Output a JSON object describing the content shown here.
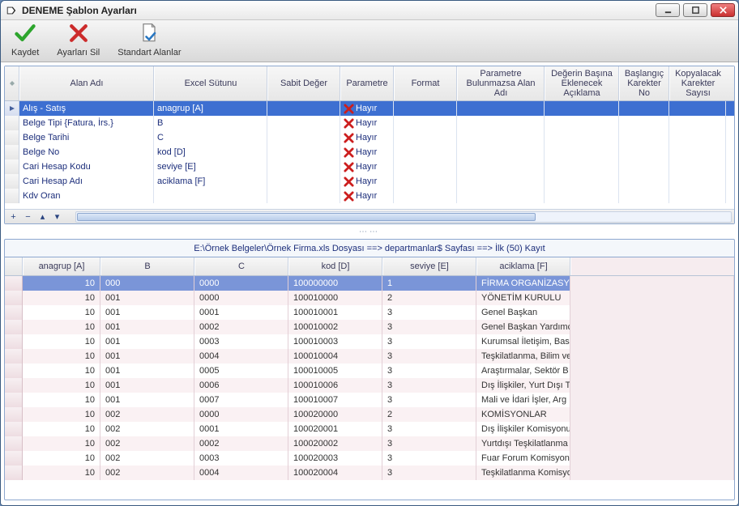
{
  "window": {
    "title": "DENEME Şablon Ayarları"
  },
  "toolbar": {
    "save": "Kaydet",
    "delete": "Ayarları Sil",
    "stdfields": "Standart Alanlar"
  },
  "grid1": {
    "headers": [
      "Alan Adı",
      "Excel Sütunu",
      "Sabit Değer",
      "Parametre",
      "Format",
      "Parametre Bulunmazsa Alan Adı",
      "Değerin Başına Eklenecek Açıklama",
      "Başlangıç Karekter No",
      "Kopyalacak Karekter Sayısı"
    ],
    "rows": [
      {
        "alan": "Alış - Satış",
        "excel": "anagrup [A]",
        "param": "Hayır",
        "selected": true
      },
      {
        "alan": "Belge Tipi {Fatura, İrs.}",
        "excel": "B",
        "param": "Hayır"
      },
      {
        "alan": "Belge Tarihi",
        "excel": "C",
        "param": "Hayır"
      },
      {
        "alan": "Belge No",
        "excel": "kod [D]",
        "param": "Hayır"
      },
      {
        "alan": "Cari Hesap Kodu",
        "excel": "seviye [E]",
        "param": "Hayır"
      },
      {
        "alan": "Cari Hesap Adı",
        "excel": "aciklama [F]",
        "param": "Hayır"
      },
      {
        "alan": "Kdv Oran",
        "excel": "",
        "param": "Hayır"
      }
    ]
  },
  "pathbar": "E:\\Örnek Belgeler\\Örnek Firma.xls Dosyası ==> departmanlar$ Sayfası ==> İlk (50) Kayıt",
  "grid2": {
    "headers": [
      "anagrup [A]",
      "B",
      "C",
      "kod [D]",
      "seviye [E]",
      "aciklama [F]"
    ],
    "rows": [
      {
        "a": "10",
        "b": "000",
        "c": "0000",
        "d": "100000000",
        "e": "1",
        "f": "FİRMA ORGANİZASYO",
        "selected": true
      },
      {
        "a": "10",
        "b": "001",
        "c": "0000",
        "d": "100010000",
        "e": "2",
        "f": "YÖNETİM KURULU"
      },
      {
        "a": "10",
        "b": "001",
        "c": "0001",
        "d": "100010001",
        "e": "3",
        "f": "Genel Başkan"
      },
      {
        "a": "10",
        "b": "001",
        "c": "0002",
        "d": "100010002",
        "e": "3",
        "f": "Genel Başkan Yardımcı"
      },
      {
        "a": "10",
        "b": "001",
        "c": "0003",
        "d": "100010003",
        "e": "3",
        "f": "Kurumsal İletişim,  Bas"
      },
      {
        "a": "10",
        "b": "001",
        "c": "0004",
        "d": "100010004",
        "e": "3",
        "f": "Teşkilatlanma, Bilim ve"
      },
      {
        "a": "10",
        "b": "001",
        "c": "0005",
        "d": "100010005",
        "e": "3",
        "f": "Araştırmalar, Sektör B"
      },
      {
        "a": "10",
        "b": "001",
        "c": "0006",
        "d": "100010006",
        "e": "3",
        "f": "Dış İlişkiler, Yurt Dışı Te"
      },
      {
        "a": "10",
        "b": "001",
        "c": "0007",
        "d": "100010007",
        "e": "3",
        "f": "Mali ve İdari İşler, Arg"
      },
      {
        "a": "10",
        "b": "002",
        "c": "0000",
        "d": "100020000",
        "e": "2",
        "f": "KOMİSYONLAR"
      },
      {
        "a": "10",
        "b": "002",
        "c": "0001",
        "d": "100020001",
        "e": "3",
        "f": "Dış İlişkiler Komisyonu"
      },
      {
        "a": "10",
        "b": "002",
        "c": "0002",
        "d": "100020002",
        "e": "3",
        "f": "Yurtdışı Teşkilatlanma"
      },
      {
        "a": "10",
        "b": "002",
        "c": "0003",
        "d": "100020003",
        "e": "3",
        "f": "Fuar Forum Komisyon"
      },
      {
        "a": "10",
        "b": "002",
        "c": "0004",
        "d": "100020004",
        "e": "3",
        "f": "Teşkilatlanma Komisyo"
      }
    ]
  },
  "splitter_dots": "⋯⋯"
}
